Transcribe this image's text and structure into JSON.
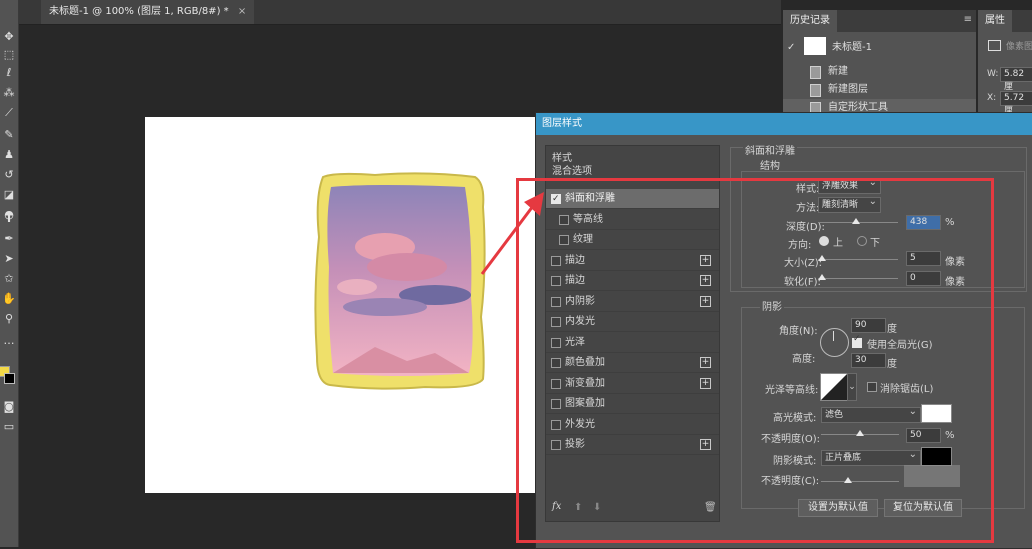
{
  "document": {
    "tab_title": "未标题-1 @ 100% (图层 1, RGB/8#) *",
    "close_glyph": "×"
  },
  "history_panel": {
    "tab": "历史记录",
    "snapshot_label": "未标题-1",
    "items": [
      {
        "label": "新建"
      },
      {
        "label": "新建图层"
      },
      {
        "label": "自定形状工具"
      }
    ]
  },
  "properties_panel": {
    "tab": "属性",
    "w_label": "W:",
    "w_value": "5.82 厘",
    "x_label": "X:",
    "x_value": "5.72 厘",
    "partial_text": "像素图"
  },
  "dialog": {
    "title": "图层样式",
    "styles_header": "样式",
    "blend_options": "混合选项",
    "items": [
      {
        "label": "斜面和浮雕",
        "checked": true,
        "plus": false
      },
      {
        "label": "等高线",
        "checked": false,
        "plus": false
      },
      {
        "label": "纹理",
        "checked": false,
        "plus": false
      },
      {
        "label": "描边",
        "checked": false,
        "plus": true
      },
      {
        "label": "描边",
        "checked": false,
        "plus": true
      },
      {
        "label": "内阴影",
        "checked": false,
        "plus": true
      },
      {
        "label": "内发光",
        "checked": false,
        "plus": false
      },
      {
        "label": "光泽",
        "checked": false,
        "plus": false
      },
      {
        "label": "颜色叠加",
        "checked": false,
        "plus": true
      },
      {
        "label": "渐变叠加",
        "checked": false,
        "plus": true
      },
      {
        "label": "图案叠加",
        "checked": false,
        "plus": false
      },
      {
        "label": "外发光",
        "checked": false,
        "plus": false
      },
      {
        "label": "投影",
        "checked": false,
        "plus": true
      }
    ],
    "fx_label": "fx",
    "bevel": {
      "section_title": "斜面和浮雕",
      "structure_title": "结构",
      "style_label": "样式:",
      "style_value": "浮雕效果",
      "technique_label": "方法:",
      "technique_value": "雕刻清晰",
      "depth_label": "深度(D):",
      "depth_value": "438",
      "depth_unit": "%",
      "direction_label": "方向:",
      "direction_up": "上",
      "direction_down": "下",
      "size_label": "大小(Z):",
      "size_value": "5",
      "size_unit": "像素",
      "soften_label": "软化(F):",
      "soften_value": "0",
      "soften_unit": "像素"
    },
    "shading": {
      "title": "阴影",
      "angle_label": "角度(N):",
      "angle_value": "90",
      "angle_unit": "度",
      "global_light_label": "使用全局光(G)",
      "altitude_label": "高度:",
      "altitude_value": "30",
      "altitude_unit": "度",
      "gloss_contour_label": "光泽等高线:",
      "anti_alias_label": "消除锯齿(L)",
      "highlight_mode_label": "高光模式:",
      "highlight_mode_value": "滤色",
      "highlight_opacity_label": "不透明度(O):",
      "highlight_opacity_value": "50",
      "highlight_opacity_unit": "%",
      "shadow_mode_label": "阴影模式:",
      "shadow_mode_value": "正片叠底",
      "shadow_opacity_label": "不透明度(C):"
    },
    "buttons": {
      "make_default": "设置为默认值",
      "reset_default": "复位为默认值"
    }
  },
  "colors": {
    "accent": "#3896c7",
    "highlight": "#e53940",
    "frame": "#efe06a",
    "fg_swatch": "#f2d848",
    "bg_swatch": "#000000"
  }
}
